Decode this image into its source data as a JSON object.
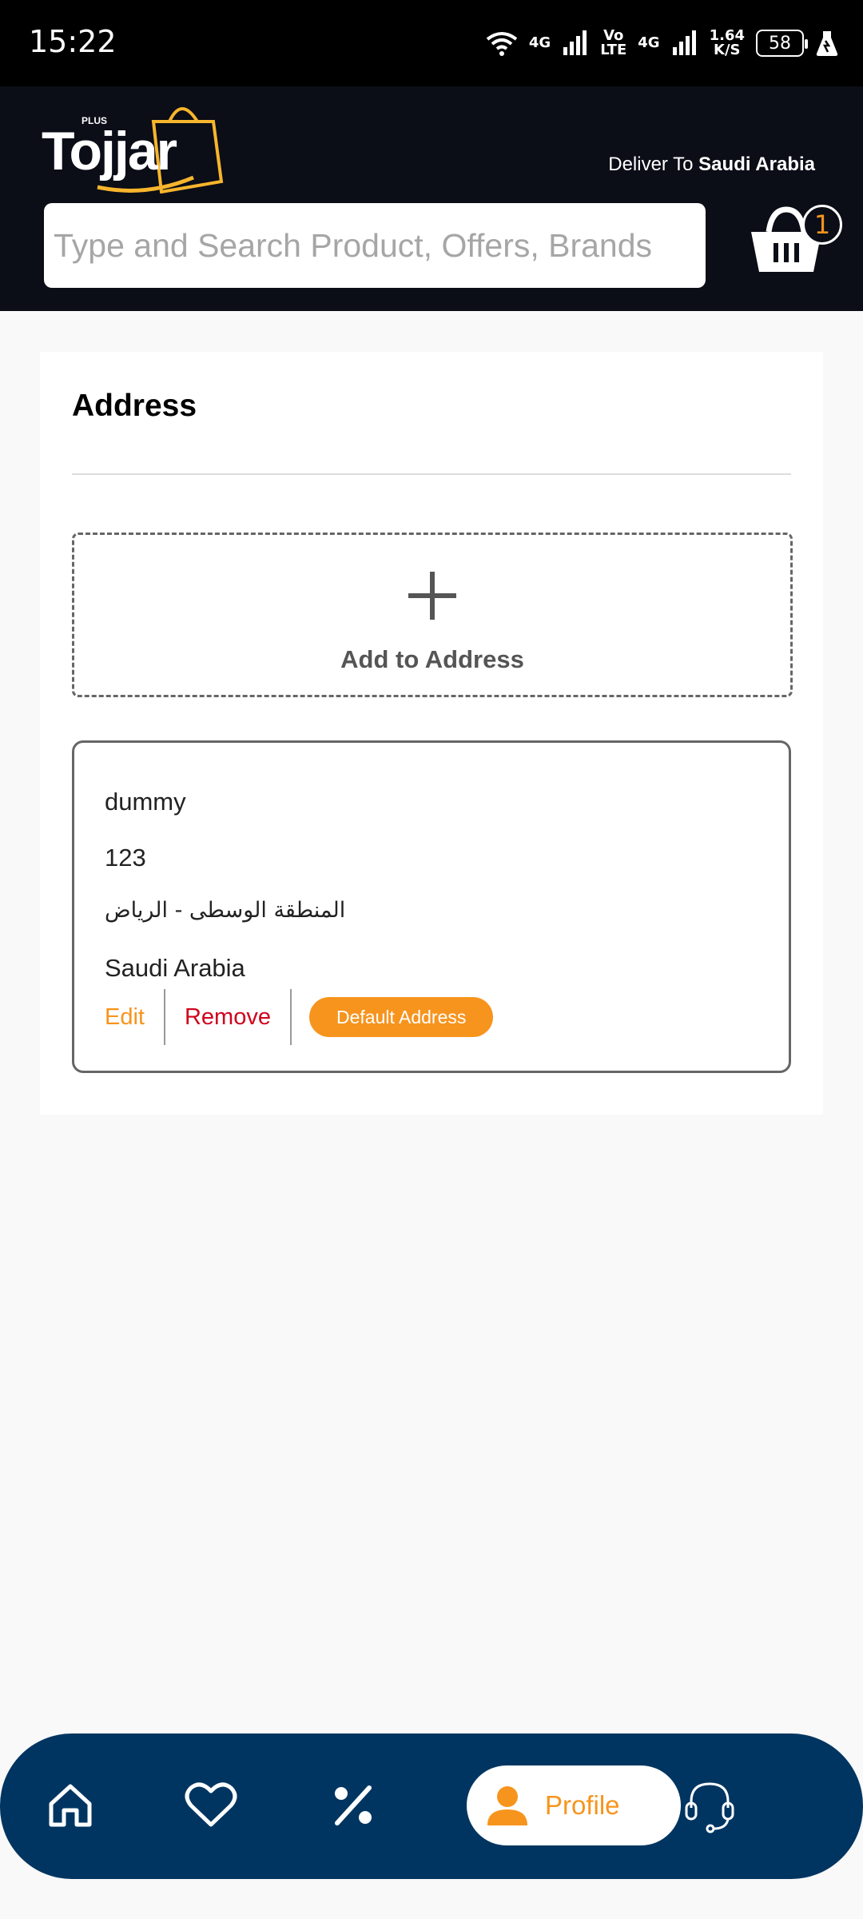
{
  "status_bar": {
    "time": "15:22",
    "net1": "4G",
    "volte_top": "Vo",
    "volte_bottom": "LTE",
    "net2": "4G",
    "speed_value": "1.64",
    "speed_unit": "K/S",
    "battery": "58"
  },
  "header": {
    "logo_text": "Tojjar",
    "logo_plus": "PLUS",
    "deliver_prefix": "Deliver To",
    "deliver_country": "Saudi Arabia",
    "search_placeholder": "Type and Search Product, Offers, Brands",
    "cart_count": "1"
  },
  "address_page": {
    "title": "Address",
    "add_label": "Add to Address",
    "addresses": [
      {
        "name": "dummy",
        "number": "123",
        "region": "المنطقة الوسطى - الرياض",
        "country": "Saudi Arabia",
        "edit_label": "Edit",
        "remove_label": "Remove",
        "default_label": "Default Address"
      }
    ]
  },
  "bottom_nav": {
    "profile_label": "Profile"
  },
  "colors": {
    "accent": "#f7941d",
    "header_bg": "#0b0d17",
    "nav_bg": "#003561",
    "remove": "#d0021b"
  },
  "icons": [
    "wifi-icon",
    "signal-icon",
    "battery-icon",
    "cart-icon",
    "plus-icon",
    "home-icon",
    "heart-icon",
    "percent-icon",
    "user-icon",
    "headset-icon"
  ]
}
